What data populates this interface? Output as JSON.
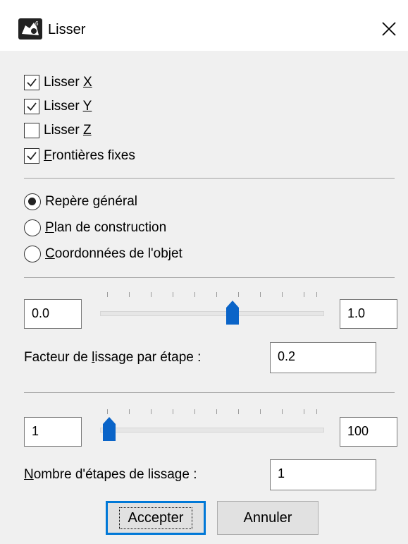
{
  "window": {
    "title": "Lisser",
    "app_icon": "rhino-icon",
    "close_icon": "close-icon"
  },
  "options": {
    "checkboxes": [
      {
        "pre": "Lisser ",
        "key": "X",
        "post": "",
        "checked": true
      },
      {
        "pre": "Lisser ",
        "key": "Y",
        "post": "",
        "checked": true
      },
      {
        "pre": "Lisser ",
        "key": "Z",
        "post": "",
        "checked": false
      },
      {
        "pre": "",
        "key": "F",
        "post": "rontières fixes",
        "checked": true
      }
    ],
    "radios": [
      {
        "pre": "Repère ",
        "key": "g",
        "post": "énéral",
        "selected": true
      },
      {
        "pre": "",
        "key": "P",
        "post": "lan de construction",
        "selected": false
      },
      {
        "pre": "",
        "key": "C",
        "post": "oordonnées de l'objet",
        "selected": false
      }
    ]
  },
  "factor": {
    "min_value": "0.0",
    "max_value": "1.0",
    "slider_position": 0.6,
    "label_pre": "Facteur de ",
    "label_key": "l",
    "label_post": "issage par étape :",
    "value": "0.2"
  },
  "steps": {
    "min_value": "1",
    "max_value": "100",
    "slider_position": 0.0,
    "label_pre": "",
    "label_key": "N",
    "label_post": "ombre d'étapes de lissage :",
    "value": "1"
  },
  "buttons": {
    "accept": "Accepter",
    "cancel": "Annuler"
  },
  "colors": {
    "accent": "#0078d7",
    "slider_thumb": "#0a64c8"
  }
}
